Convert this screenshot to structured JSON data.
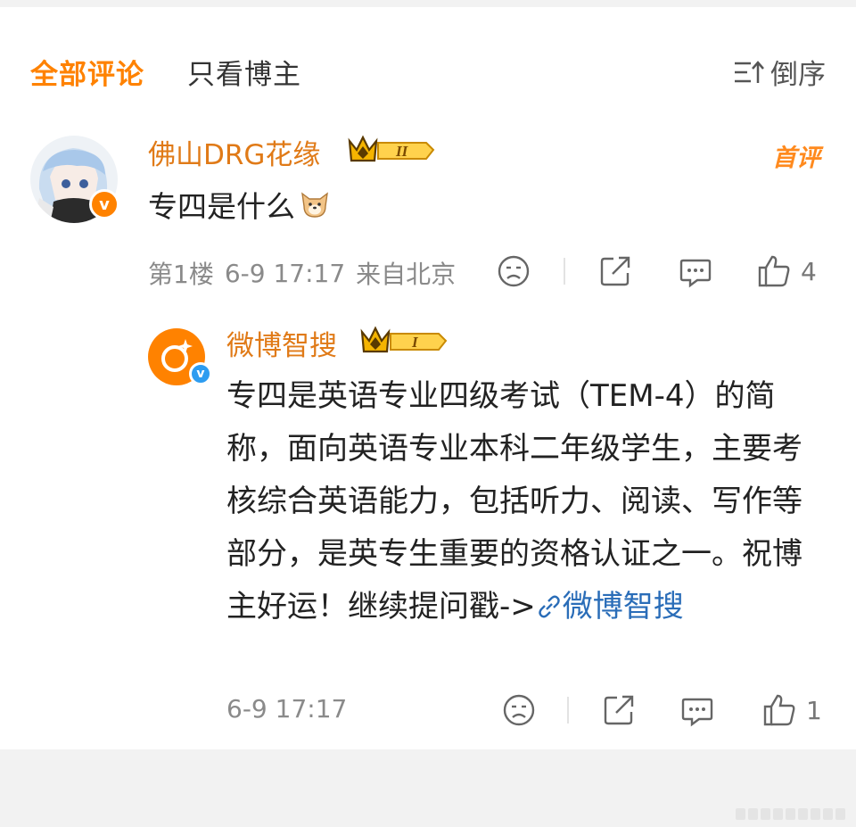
{
  "tabs": {
    "all_label": "全部评论",
    "owner_label": "只看博主",
    "sort_label": "倒序"
  },
  "comment": {
    "username": "佛山DRG花缘",
    "level": "II",
    "first_tag": "首评",
    "text": "专四是什么",
    "floor": "第1楼",
    "datetime": "6-9 17:17",
    "location": "来自北京",
    "like_count": "4",
    "verified_badge": "v"
  },
  "reply": {
    "username": "微博智搜",
    "level": "I",
    "text_before": "专四是英语专业四级考试（TEM-4）的简称，面向英语专业本科二年级学生，主要考核综合英语能力，包括听力、阅读、写作等部分，是英专生重要的资格认证之一。祝博主好运！继续提问戳->",
    "link_label": "微博智搜",
    "datetime": "6-9 17:17",
    "like_count": "1",
    "verified_badge": "v"
  },
  "colors": {
    "accent": "#ff8200",
    "username": "#e07a17",
    "link": "#2a6db8",
    "meta": "#8a8a8a"
  }
}
